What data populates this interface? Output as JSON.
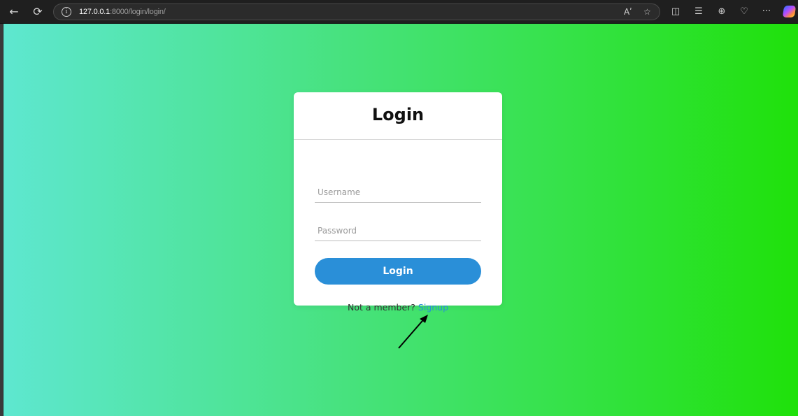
{
  "browser": {
    "url_host": "127.0.0.1",
    "url_rest": ":8000/login/login/",
    "back_icon": "arrow-left-icon",
    "reload_icon": "reload-icon",
    "read_aloud_label": "Aʹ",
    "more_label": "···"
  },
  "page": {
    "gradient_start": "#5ee7d0",
    "gradient_end": "#1fe10a"
  },
  "login_card": {
    "title": "Login",
    "username_placeholder": "Username",
    "password_placeholder": "Password",
    "submit_label": "Login",
    "signup_prompt": "Not a member?",
    "signup_link": "Signup",
    "accent_color": "#2a8fd8"
  }
}
